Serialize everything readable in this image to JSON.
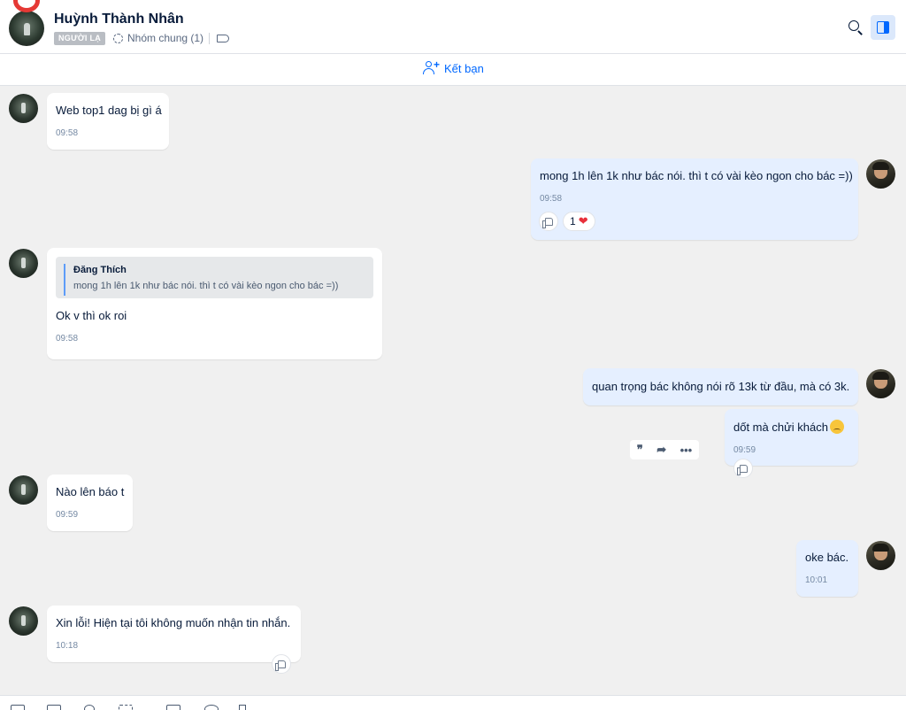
{
  "header": {
    "name": "Huỳnh Thành Nhân",
    "badge": "NGƯỜI LẠ",
    "group_label": "Nhóm chung (1)",
    "icons": [
      "search-icon",
      "panel-toggle-icon",
      "tag-icon"
    ]
  },
  "add_friend": {
    "label": "Kết bạn"
  },
  "messages": [
    {
      "side": "in",
      "text": "Web top1 dag bị gì á",
      "time": "09:58"
    },
    {
      "side": "out",
      "text": "mong 1h lên 1k như bác nói. thì t có vài kèo ngon cho bác =))",
      "time": "09:58",
      "reaction_count": "1"
    },
    {
      "side": "in",
      "quote_name": "Đăng Thích",
      "quote_text": "mong 1h lên 1k như bác nói. thì t có vài kèo ngon cho bác =))",
      "text": "Ok v thì ok roi",
      "time": "09:58"
    },
    {
      "side": "out",
      "text": "quan trọng bác không nói rõ 13k từ đầu, mà có 3k."
    },
    {
      "side": "out",
      "text": "dốt mà chửi khách",
      "time": "09:59"
    },
    {
      "side": "in",
      "text": "Nào lên báo t",
      "time": "09:59"
    },
    {
      "side": "out",
      "text": "oke bác.",
      "time": "10:01"
    },
    {
      "side": "in",
      "text": "Xin lỗi! Hiện tại tôi không muốn nhận tin nhắn.",
      "time": "10:18"
    }
  ],
  "hover_tools": {
    "quote": "❞",
    "forward": "➦",
    "more": "•••"
  }
}
